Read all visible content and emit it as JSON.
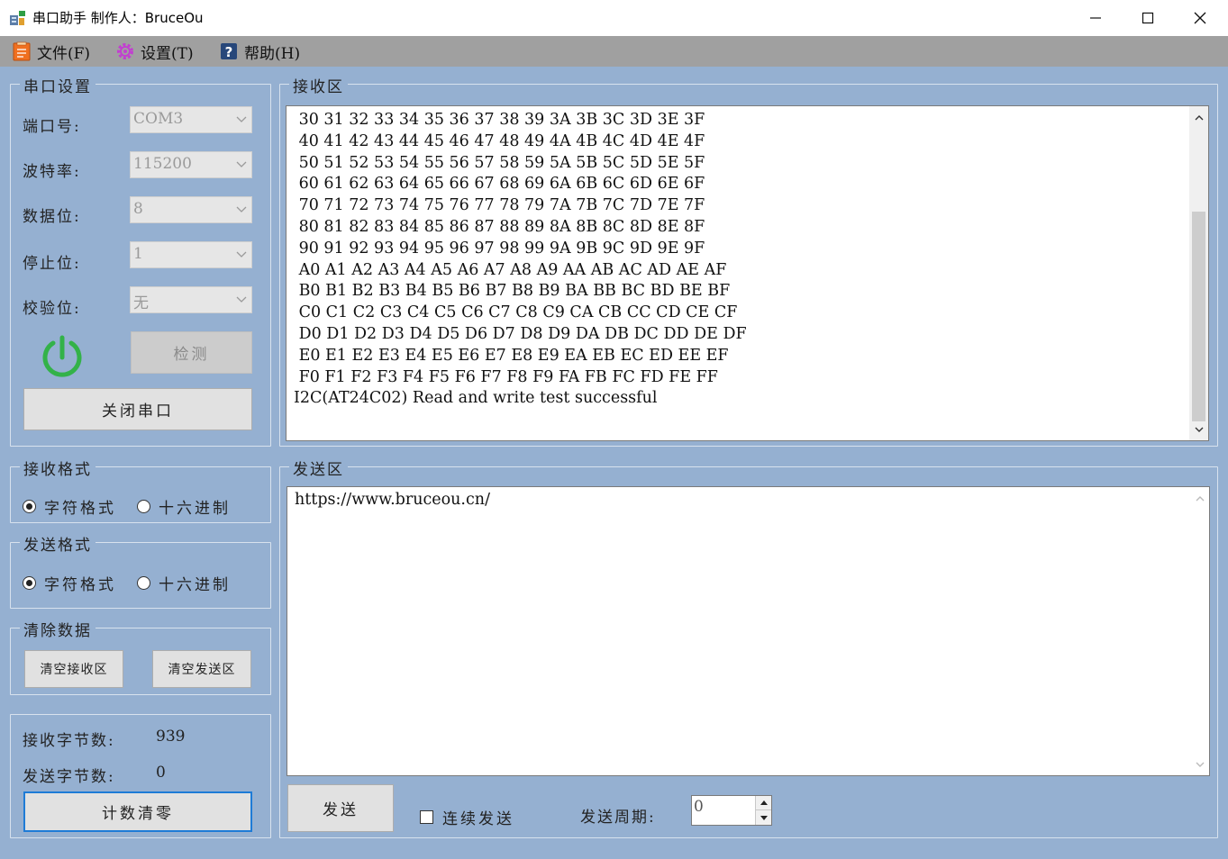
{
  "window": {
    "title": "串口助手 制作人：BruceOu",
    "minimize_icon": "minimize-icon",
    "maximize_icon": "maximize-icon",
    "close_icon": "close-icon"
  },
  "menu": {
    "file": "文件(F)",
    "settings": "设置(T)",
    "help": "帮助(H)"
  },
  "serial_settings": {
    "legend": "串口设置",
    "port_label": "端口号:",
    "port_value": "COM3",
    "baud_label": "波特率:",
    "baud_value": "115200",
    "databits_label": "数据位:",
    "databits_value": "8",
    "stopbits_label": "停止位:",
    "stopbits_value": "1",
    "parity_label": "校验位:",
    "parity_value": "无",
    "detect_button": "检测",
    "close_port_button": "关闭串口",
    "power_color": "#33b249"
  },
  "receive_format": {
    "legend": "接收格式",
    "option_char": "字符格式",
    "option_hex": "十六进制"
  },
  "send_format": {
    "legend": "发送格式",
    "option_char": "字符格式",
    "option_hex": "十六进制"
  },
  "clear_data": {
    "legend": "清除数据",
    "clear_receive": "清空接收区",
    "clear_send": "清空发送区"
  },
  "counters": {
    "recv_label": "接收字节数:",
    "recv_value": "939",
    "send_label": "发送字节数:",
    "send_value": "0",
    "reset_button": "计数清零"
  },
  "receive_area": {
    "legend": "接收区",
    "lines": [
      " 30 31 32 33 34 35 36 37 38 39 3A 3B 3C 3D 3E 3F",
      " 40 41 42 43 44 45 46 47 48 49 4A 4B 4C 4D 4E 4F",
      " 50 51 52 53 54 55 56 57 58 59 5A 5B 5C 5D 5E 5F",
      " 60 61 62 63 64 65 66 67 68 69 6A 6B 6C 6D 6E 6F",
      " 70 71 72 73 74 75 76 77 78 79 7A 7B 7C 7D 7E 7F",
      " 80 81 82 83 84 85 86 87 88 89 8A 8B 8C 8D 8E 8F",
      " 90 91 92 93 94 95 96 97 98 99 9A 9B 9C 9D 9E 9F",
      " A0 A1 A2 A3 A4 A5 A6 A7 A8 A9 AA AB AC AD AE AF",
      " B0 B1 B2 B3 B4 B5 B6 B7 B8 B9 BA BB BC BD BE BF",
      " C0 C1 C2 C3 C4 C5 C6 C7 C8 C9 CA CB CC CD CE CF",
      " D0 D1 D2 D3 D4 D5 D6 D7 D8 D9 DA DB DC DD DE DF",
      " E0 E1 E2 E3 E4 E5 E6 E7 E8 E9 EA EB EC ED EE EF",
      " F0 F1 F2 F3 F4 F5 F6 F7 F8 F9 FA FB FC FD FE FF",
      "I2C(AT24C02) Read and write test successful"
    ]
  },
  "send_area": {
    "legend": "发送区",
    "text": "https://www.bruceou.cn/",
    "send_button": "发送",
    "continuous_label": "连续发送",
    "period_label": "发送周期:",
    "period_value": "0"
  }
}
